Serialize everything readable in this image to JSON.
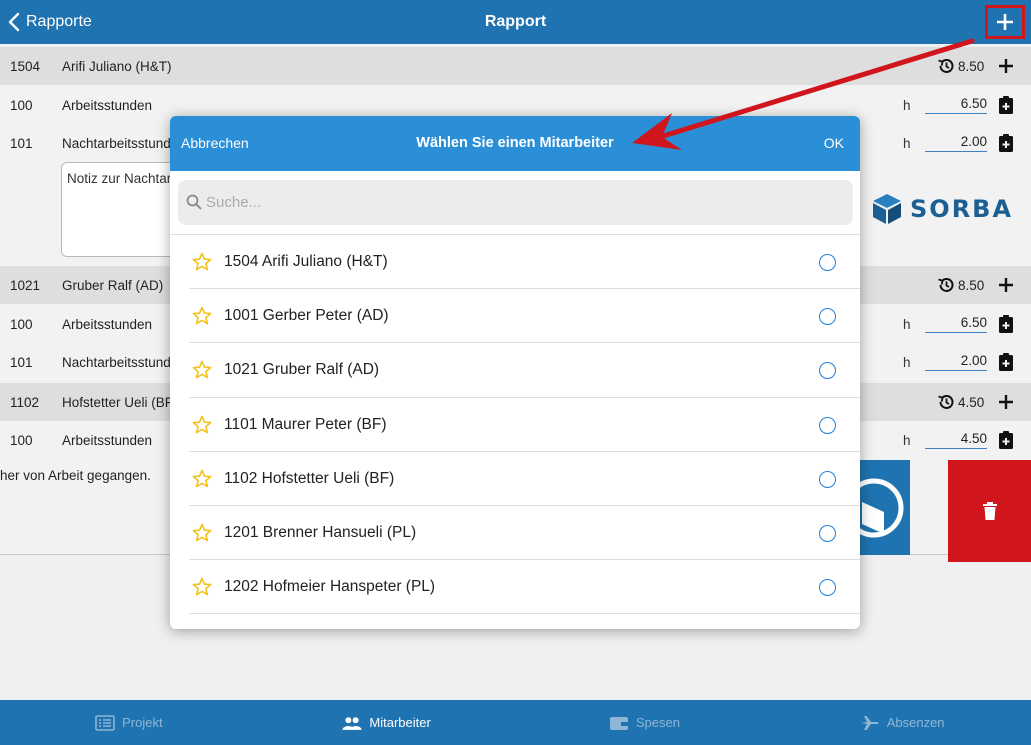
{
  "navbar": {
    "back_label": "Rapporte",
    "title": "Rapport"
  },
  "report": {
    "groups": [
      {
        "code": "1504",
        "name": "Arifi Juliano (H&T)",
        "total": "8.50",
        "items": [
          {
            "code": "100",
            "name": "Arbeitsstunden",
            "unit": "h",
            "value": "6.50"
          },
          {
            "code": "101",
            "name": "Nachtarbeitsstunden",
            "unit": "h",
            "value": "2.00"
          }
        ],
        "note": "Notiz zur Nachtarbeit"
      },
      {
        "code": "1021",
        "name": "Gruber Ralf (AD)",
        "total": "8.50",
        "items": [
          {
            "code": "100",
            "name": "Arbeitsstunden",
            "unit": "h",
            "value": "6.50"
          },
          {
            "code": "101",
            "name": "Nachtarbeitsstunden",
            "unit": "h",
            "value": "2.00"
          }
        ]
      },
      {
        "code": "1102",
        "name": "Hofstetter Ueli (BF)",
        "total": "4.50",
        "items": [
          {
            "code": "100",
            "name": "Arbeitsstunden",
            "unit": "h",
            "value": "4.50"
          }
        ]
      }
    ],
    "comment": "her von Arbeit gegangen.",
    "logo_text": "SORBA"
  },
  "modal": {
    "cancel_label": "Abbrechen",
    "title": "Wählen Sie einen Mitarbeiter",
    "ok_label": "OK",
    "search_placeholder": "Suche...",
    "employees": [
      "1504 Arifi Juliano (H&T)",
      "1001 Gerber Peter (AD)",
      "1021 Gruber Ralf (AD)",
      "1101 Maurer Peter (BF)",
      "1102 Hofstetter Ueli (BF)",
      "1201 Brenner Hansueli (PL)",
      "1202 Hofmeier Hanspeter (PL)"
    ]
  },
  "tabbar": {
    "tabs": [
      {
        "label": "Projekt",
        "icon": "list-icon",
        "active": false
      },
      {
        "label": "Mitarbeiter",
        "icon": "people-icon",
        "active": true
      },
      {
        "label": "Spesen",
        "icon": "wallet-icon",
        "active": false
      },
      {
        "label": "Absenzen",
        "icon": "airplane-icon",
        "active": false
      }
    ]
  },
  "colors": {
    "navbar": "#1f73b0",
    "modal_header": "#2b8fd8",
    "highlight": "#d0151c",
    "star": "#f2c21b",
    "radio": "#1f7fd8"
  }
}
